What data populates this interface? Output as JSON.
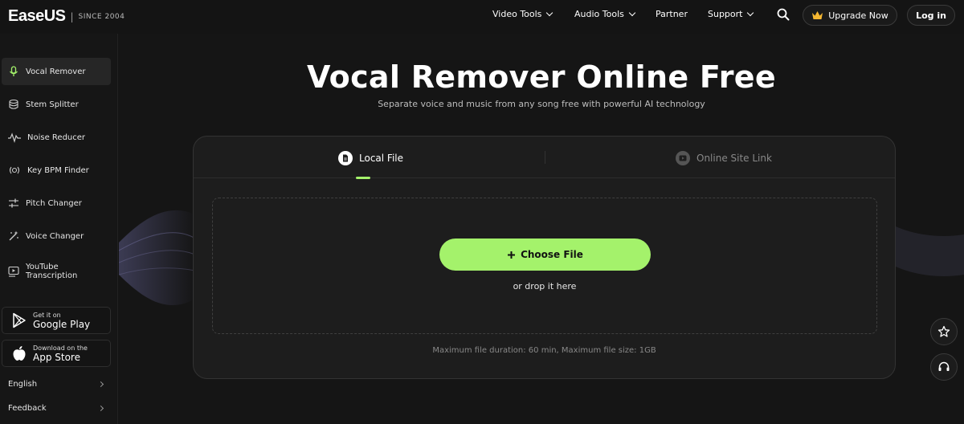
{
  "header": {
    "logo": "EaseUS",
    "separator": "|",
    "since": "SINCE 2004",
    "nav": [
      {
        "label": "Video Tools"
      },
      {
        "label": "Audio Tools"
      },
      {
        "label": "Partner"
      },
      {
        "label": "Support"
      }
    ],
    "upgrade_label": "Upgrade Now",
    "login_label": "Log in",
    "icons": {
      "search": "search-icon",
      "upgrade": "crown-icon"
    }
  },
  "sidebar": {
    "items": [
      {
        "label": "Vocal Remover",
        "icon": "microphone-icon",
        "active": true
      },
      {
        "label": "Stem Splitter",
        "icon": "stack-icon"
      },
      {
        "label": "Noise Reducer",
        "icon": "waveform-icon"
      },
      {
        "label": "Key BPM Finder",
        "icon": "radar-icon"
      },
      {
        "label": "Pitch Changer",
        "icon": "sliders-icon"
      },
      {
        "label": "Voice Changer",
        "icon": "magic-wand-icon"
      },
      {
        "label_line1": "YouTube",
        "label_line2": "Transcription",
        "icon": "video-text-icon"
      }
    ],
    "google_play": {
      "small": "Get it on",
      "big": "Google Play"
    },
    "app_store": {
      "small": "Download on the",
      "big": "App Store"
    },
    "language": "English",
    "feedback": "Feedback"
  },
  "main": {
    "title": "Vocal Remover Online Free",
    "subtitle": "Separate voice and music from any song free with powerful AI technology",
    "tabs": [
      {
        "label": "Local File",
        "active": true,
        "icon": "file-icon"
      },
      {
        "label": "Online Site Link",
        "icon": "link-video-icon"
      }
    ],
    "choose_label": "Choose File",
    "drop_label": "or drop it here",
    "limits": "Maximum file duration: 60 min, Maximum file size: 1GB",
    "accent": "#a4f26b"
  },
  "floating": {
    "favorite_icon": "star-icon",
    "support_icon": "headset-icon"
  }
}
